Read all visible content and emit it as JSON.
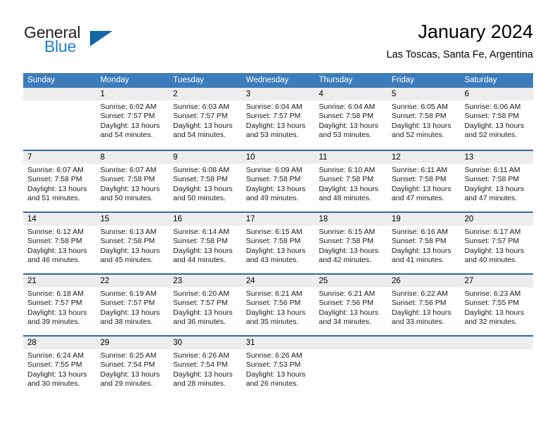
{
  "brand": {
    "name_part1": "General",
    "name_part2": "Blue",
    "accent_color": "#1f7fc4",
    "triangle_color": "#1567a8"
  },
  "header": {
    "title": "January 2024",
    "subtitle": "Las Toscas, Santa Fe, Argentina"
  },
  "calendar": {
    "header_bg": "#3d7cba",
    "row_divider": "#35699f",
    "day_band_bg": "#ededed",
    "weekdays": [
      "Sunday",
      "Monday",
      "Tuesday",
      "Wednesday",
      "Thursday",
      "Friday",
      "Saturday"
    ],
    "weeks": [
      [
        {
          "day": "",
          "sunrise": "",
          "sunset": "",
          "daylight_line1": "",
          "daylight_line2": ""
        },
        {
          "day": "1",
          "sunrise": "Sunrise: 6:02 AM",
          "sunset": "Sunset: 7:57 PM",
          "daylight_line1": "Daylight: 13 hours",
          "daylight_line2": "and 54 minutes."
        },
        {
          "day": "2",
          "sunrise": "Sunrise: 6:03 AM",
          "sunset": "Sunset: 7:57 PM",
          "daylight_line1": "Daylight: 13 hours",
          "daylight_line2": "and 54 minutes."
        },
        {
          "day": "3",
          "sunrise": "Sunrise: 6:04 AM",
          "sunset": "Sunset: 7:57 PM",
          "daylight_line1": "Daylight: 13 hours",
          "daylight_line2": "and 53 minutes."
        },
        {
          "day": "4",
          "sunrise": "Sunrise: 6:04 AM",
          "sunset": "Sunset: 7:58 PM",
          "daylight_line1": "Daylight: 13 hours",
          "daylight_line2": "and 53 minutes."
        },
        {
          "day": "5",
          "sunrise": "Sunrise: 6:05 AM",
          "sunset": "Sunset: 7:58 PM",
          "daylight_line1": "Daylight: 13 hours",
          "daylight_line2": "and 52 minutes."
        },
        {
          "day": "6",
          "sunrise": "Sunrise: 6:06 AM",
          "sunset": "Sunset: 7:58 PM",
          "daylight_line1": "Daylight: 13 hours",
          "daylight_line2": "and 52 minutes."
        }
      ],
      [
        {
          "day": "7",
          "sunrise": "Sunrise: 6:07 AM",
          "sunset": "Sunset: 7:58 PM",
          "daylight_line1": "Daylight: 13 hours",
          "daylight_line2": "and 51 minutes."
        },
        {
          "day": "8",
          "sunrise": "Sunrise: 6:07 AM",
          "sunset": "Sunset: 7:58 PM",
          "daylight_line1": "Daylight: 13 hours",
          "daylight_line2": "and 50 minutes."
        },
        {
          "day": "9",
          "sunrise": "Sunrise: 6:08 AM",
          "sunset": "Sunset: 7:58 PM",
          "daylight_line1": "Daylight: 13 hours",
          "daylight_line2": "and 50 minutes."
        },
        {
          "day": "10",
          "sunrise": "Sunrise: 6:09 AM",
          "sunset": "Sunset: 7:58 PM",
          "daylight_line1": "Daylight: 13 hours",
          "daylight_line2": "and 49 minutes."
        },
        {
          "day": "11",
          "sunrise": "Sunrise: 6:10 AM",
          "sunset": "Sunset: 7:58 PM",
          "daylight_line1": "Daylight: 13 hours",
          "daylight_line2": "and 48 minutes."
        },
        {
          "day": "12",
          "sunrise": "Sunrise: 6:11 AM",
          "sunset": "Sunset: 7:58 PM",
          "daylight_line1": "Daylight: 13 hours",
          "daylight_line2": "and 47 minutes."
        },
        {
          "day": "13",
          "sunrise": "Sunrise: 6:11 AM",
          "sunset": "Sunset: 7:58 PM",
          "daylight_line1": "Daylight: 13 hours",
          "daylight_line2": "and 47 minutes."
        }
      ],
      [
        {
          "day": "14",
          "sunrise": "Sunrise: 6:12 AM",
          "sunset": "Sunset: 7:58 PM",
          "daylight_line1": "Daylight: 13 hours",
          "daylight_line2": "and 46 minutes."
        },
        {
          "day": "15",
          "sunrise": "Sunrise: 6:13 AM",
          "sunset": "Sunset: 7:58 PM",
          "daylight_line1": "Daylight: 13 hours",
          "daylight_line2": "and 45 minutes."
        },
        {
          "day": "16",
          "sunrise": "Sunrise: 6:14 AM",
          "sunset": "Sunset: 7:58 PM",
          "daylight_line1": "Daylight: 13 hours",
          "daylight_line2": "and 44 minutes."
        },
        {
          "day": "17",
          "sunrise": "Sunrise: 6:15 AM",
          "sunset": "Sunset: 7:58 PM",
          "daylight_line1": "Daylight: 13 hours",
          "daylight_line2": "and 43 minutes."
        },
        {
          "day": "18",
          "sunrise": "Sunrise: 6:15 AM",
          "sunset": "Sunset: 7:58 PM",
          "daylight_line1": "Daylight: 13 hours",
          "daylight_line2": "and 42 minutes."
        },
        {
          "day": "19",
          "sunrise": "Sunrise: 6:16 AM",
          "sunset": "Sunset: 7:58 PM",
          "daylight_line1": "Daylight: 13 hours",
          "daylight_line2": "and 41 minutes."
        },
        {
          "day": "20",
          "sunrise": "Sunrise: 6:17 AM",
          "sunset": "Sunset: 7:57 PM",
          "daylight_line1": "Daylight: 13 hours",
          "daylight_line2": "and 40 minutes."
        }
      ],
      [
        {
          "day": "21",
          "sunrise": "Sunrise: 6:18 AM",
          "sunset": "Sunset: 7:57 PM",
          "daylight_line1": "Daylight: 13 hours",
          "daylight_line2": "and 39 minutes."
        },
        {
          "day": "22",
          "sunrise": "Sunrise: 6:19 AM",
          "sunset": "Sunset: 7:57 PM",
          "daylight_line1": "Daylight: 13 hours",
          "daylight_line2": "and 38 minutes."
        },
        {
          "day": "23",
          "sunrise": "Sunrise: 6:20 AM",
          "sunset": "Sunset: 7:57 PM",
          "daylight_line1": "Daylight: 13 hours",
          "daylight_line2": "and 36 minutes."
        },
        {
          "day": "24",
          "sunrise": "Sunrise: 6:21 AM",
          "sunset": "Sunset: 7:56 PM",
          "daylight_line1": "Daylight: 13 hours",
          "daylight_line2": "and 35 minutes."
        },
        {
          "day": "25",
          "sunrise": "Sunrise: 6:21 AM",
          "sunset": "Sunset: 7:56 PM",
          "daylight_line1": "Daylight: 13 hours",
          "daylight_line2": "and 34 minutes."
        },
        {
          "day": "26",
          "sunrise": "Sunrise: 6:22 AM",
          "sunset": "Sunset: 7:56 PM",
          "daylight_line1": "Daylight: 13 hours",
          "daylight_line2": "and 33 minutes."
        },
        {
          "day": "27",
          "sunrise": "Sunrise: 6:23 AM",
          "sunset": "Sunset: 7:55 PM",
          "daylight_line1": "Daylight: 13 hours",
          "daylight_line2": "and 32 minutes."
        }
      ],
      [
        {
          "day": "28",
          "sunrise": "Sunrise: 6:24 AM",
          "sunset": "Sunset: 7:55 PM",
          "daylight_line1": "Daylight: 13 hours",
          "daylight_line2": "and 30 minutes."
        },
        {
          "day": "29",
          "sunrise": "Sunrise: 6:25 AM",
          "sunset": "Sunset: 7:54 PM",
          "daylight_line1": "Daylight: 13 hours",
          "daylight_line2": "and 29 minutes."
        },
        {
          "day": "30",
          "sunrise": "Sunrise: 6:26 AM",
          "sunset": "Sunset: 7:54 PM",
          "daylight_line1": "Daylight: 13 hours",
          "daylight_line2": "and 28 minutes."
        },
        {
          "day": "31",
          "sunrise": "Sunrise: 6:26 AM",
          "sunset": "Sunset: 7:53 PM",
          "daylight_line1": "Daylight: 13 hours",
          "daylight_line2": "and 26 minutes."
        },
        {
          "day": "",
          "sunrise": "",
          "sunset": "",
          "daylight_line1": "",
          "daylight_line2": ""
        },
        {
          "day": "",
          "sunrise": "",
          "sunset": "",
          "daylight_line1": "",
          "daylight_line2": ""
        },
        {
          "day": "",
          "sunrise": "",
          "sunset": "",
          "daylight_line1": "",
          "daylight_line2": ""
        }
      ]
    ]
  }
}
